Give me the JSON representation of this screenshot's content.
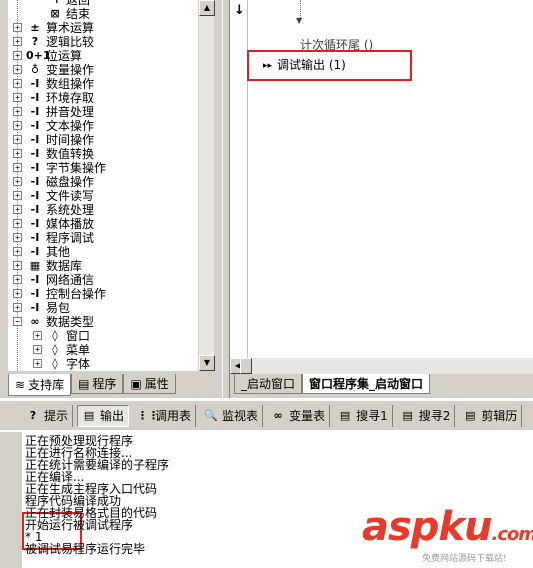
{
  "tree": {
    "items": [
      {
        "label": "返回",
        "icon": "return-icon",
        "glyph": "↰",
        "level": 2,
        "expander": ""
      },
      {
        "label": "结束",
        "icon": "end-icon",
        "glyph": "⊠",
        "level": 2,
        "expander": ""
      },
      {
        "label": "算术运算",
        "icon": "math-icon",
        "glyph": "±",
        "level": 1,
        "expander": "+"
      },
      {
        "label": "逻辑比较",
        "icon": "question-icon",
        "glyph": "?",
        "level": 1,
        "expander": "+"
      },
      {
        "label": "位运算",
        "icon": "bit-icon",
        "glyph": "0+1",
        "level": 1,
        "expander": "+"
      },
      {
        "label": "变量操作",
        "icon": "variable-icon",
        "glyph": "♁",
        "level": 1,
        "expander": "+"
      },
      {
        "label": "数组操作",
        "icon": "function-icon",
        "glyph": "-I",
        "level": 1,
        "expander": "+"
      },
      {
        "label": "环境存取",
        "icon": "function-icon",
        "glyph": "-I",
        "level": 1,
        "expander": "+"
      },
      {
        "label": "拼音处理",
        "icon": "function-icon",
        "glyph": "-I",
        "level": 1,
        "expander": "+"
      },
      {
        "label": "文本操作",
        "icon": "function-icon",
        "glyph": "-I",
        "level": 1,
        "expander": "+"
      },
      {
        "label": "时间操作",
        "icon": "function-icon",
        "glyph": "-I",
        "level": 1,
        "expander": "+"
      },
      {
        "label": "数值转换",
        "icon": "function-icon",
        "glyph": "-I",
        "level": 1,
        "expander": "+"
      },
      {
        "label": "字节集操作",
        "icon": "function-icon",
        "glyph": "-I",
        "level": 1,
        "expander": "+"
      },
      {
        "label": "磁盘操作",
        "icon": "function-icon",
        "glyph": "-I",
        "level": 1,
        "expander": "+"
      },
      {
        "label": "文件读写",
        "icon": "function-icon",
        "glyph": "-I",
        "level": 1,
        "expander": "+"
      },
      {
        "label": "系统处理",
        "icon": "function-icon",
        "glyph": "-I",
        "level": 1,
        "expander": "+"
      },
      {
        "label": "媒体播放",
        "icon": "function-icon",
        "glyph": "-I",
        "level": 1,
        "expander": "+"
      },
      {
        "label": "程序调试",
        "icon": "function-icon",
        "glyph": "-I",
        "level": 1,
        "expander": "+"
      },
      {
        "label": "其他",
        "icon": "function-icon",
        "glyph": "-I",
        "level": 1,
        "expander": "+"
      },
      {
        "label": "数据库",
        "icon": "database-icon",
        "glyph": "▦",
        "level": 1,
        "expander": "+"
      },
      {
        "label": "网络通信",
        "icon": "function-icon",
        "glyph": "-I",
        "level": 1,
        "expander": "+"
      },
      {
        "label": "控制台操作",
        "icon": "function-icon",
        "glyph": "-I",
        "level": 1,
        "expander": "+"
      },
      {
        "label": "易包",
        "icon": "function-icon",
        "glyph": "-I",
        "level": 1,
        "expander": "+"
      },
      {
        "label": "数据类型",
        "icon": "datatype-icon",
        "glyph": "∞",
        "level": 1,
        "expander": "−"
      },
      {
        "label": "窗口",
        "icon": "component-icon",
        "glyph": "◊",
        "level": 2,
        "expander": "+"
      },
      {
        "label": "菜单",
        "icon": "component-icon",
        "glyph": "◊",
        "level": 2,
        "expander": "+"
      },
      {
        "label": "字体",
        "icon": "component-icon",
        "glyph": "◊",
        "level": 2,
        "expander": "+"
      }
    ]
  },
  "left_tabs": [
    {
      "label": "支持库",
      "icon": "library-icon",
      "glyph": "≋"
    },
    {
      "label": "程序",
      "icon": "program-icon",
      "glyph": "▤"
    },
    {
      "label": "属性",
      "icon": "property-icon",
      "glyph": "▣"
    }
  ],
  "editor": {
    "arrow_glyph": "↓",
    "loop_end_text": "计次循环尾 ()",
    "debug_marker": "▸▸",
    "debug_line": "调试输出 (1)"
  },
  "code_tabs": [
    {
      "label": "_启动窗口"
    },
    {
      "label": "窗口程序集_启动窗口"
    }
  ],
  "bottom_tabs": [
    {
      "label": "提示",
      "icon": "hint-icon",
      "glyph": "?"
    },
    {
      "label": "输出",
      "icon": "output-icon",
      "glyph": "▤"
    },
    {
      "label": "调用表",
      "icon": "callstack-icon",
      "glyph": "⋮⋮"
    },
    {
      "label": "监视表",
      "icon": "watch-icon",
      "glyph": "🔍"
    },
    {
      "label": "变量表",
      "icon": "variables-icon",
      "glyph": "∞"
    },
    {
      "label": "搜寻1",
      "icon": "search-icon",
      "glyph": "▤"
    },
    {
      "label": "搜寻2",
      "icon": "search-icon",
      "glyph": "▤"
    },
    {
      "label": "剪辑历",
      "icon": "clipboard-icon",
      "glyph": "▤"
    }
  ],
  "output": {
    "lines": [
      "正在预处理现行程序",
      "正在进行名称连接...",
      "正在统计需要编译的子程序",
      "正在编译...",
      "正在生成主程序入口代码",
      "程序代码编译成功",
      "正在封装易格式目的代码",
      "开始运行被调试程序",
      "* 1",
      "被调试易程序运行完毕"
    ]
  },
  "watermark": {
    "brand": "aspku",
    "brand_suffix": ".com",
    "tagline": "免费网站源码下载站!"
  },
  "colors": {
    "highlight_box": "#e02020",
    "brand_red": "#e8392b"
  }
}
